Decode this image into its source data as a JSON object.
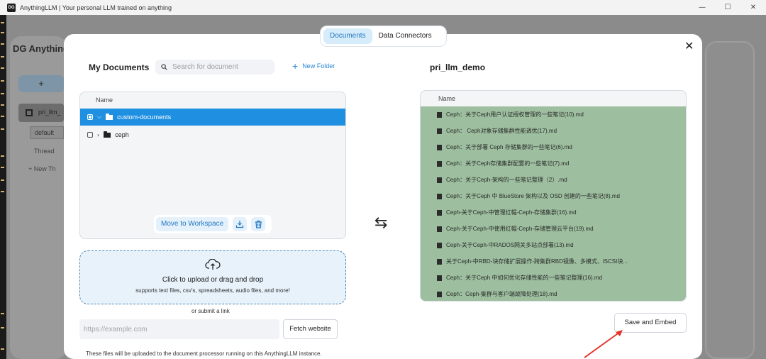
{
  "window": {
    "title": "AnythingLLM | Your personal LLM trained on anything",
    "icon_text": "DG",
    "minimize": "—",
    "maximize": "☐",
    "close": "✕"
  },
  "background_app": {
    "logo": "DG Anything",
    "new_button": "+",
    "workspace": "pri_llm_",
    "default_thread": "default",
    "thread": "Thread",
    "new_thread": "+ New Th"
  },
  "modal": {
    "tabs": [
      {
        "label": "Documents",
        "active": true
      },
      {
        "label": "Data Connectors",
        "active": false
      }
    ],
    "close": "✕",
    "my_documents": {
      "title": "My Documents",
      "search_placeholder": "Search for document",
      "new_folder": "New Folder",
      "column_name": "Name",
      "folders": [
        {
          "name": "custom-documents",
          "selected": true,
          "expanded": true
        },
        {
          "name": "ceph",
          "selected": false,
          "expanded": false
        }
      ],
      "move_button": "Move to Workspace",
      "upload_title": "Click to upload or drag and drop",
      "upload_subtitle": "supports text files, csv's, spreadsheets, audio files, and more!",
      "or_submit_link": "or submit a link",
      "url_placeholder": "https://example.com",
      "fetch_button": "Fetch website",
      "notice": "These files will be uploaded to the document processor running on this AnythingLLM instance."
    },
    "swap_icon": "⇆",
    "workspace": {
      "title": "pri_llm_demo",
      "column_name": "Name",
      "files": [
        "Ceph：关于Ceph用户认证授权管理的一些笔记(10).md",
        "Ceph： Ceph对象存储集群性能调优(17).md",
        "Ceph：关于部署 Ceph 存储集群的一些笔记(6).md",
        "Ceph：关于Ceph存储集群配置的一些笔记(7).md",
        "Ceph：关于Ceph-架构的一些笔记整理（2）.md",
        "Ceph：关于Ceph 中 BlueStore 架构以及 OSD 创建的一些笔记(8).md",
        "Ceph-关于Ceph-中管理红帽-Ceph-存储集群(16).md",
        "Ceph-关于Ceph-中使用红帽-Ceph-存储管理云平台(19).md",
        "Ceph-关于Ceph-中RADOS网关多站点部署(13).md",
        "关于Ceph-中RBD-块存储扩展操作-跨集群RBD镜像、多模式、iSCSI块...",
        "Ceph：关于Ceph 中如何优化存储性能的一些笔记整理(16).md",
        "Ceph：Ceph-集群与客户端故障处理(18).md"
      ],
      "save_button": "Save and Embed"
    }
  },
  "colors": {
    "accent": "#1e8fe1",
    "workspace_list_bg": "#9dbf9f",
    "annotation_arrow": "#e5332a"
  }
}
